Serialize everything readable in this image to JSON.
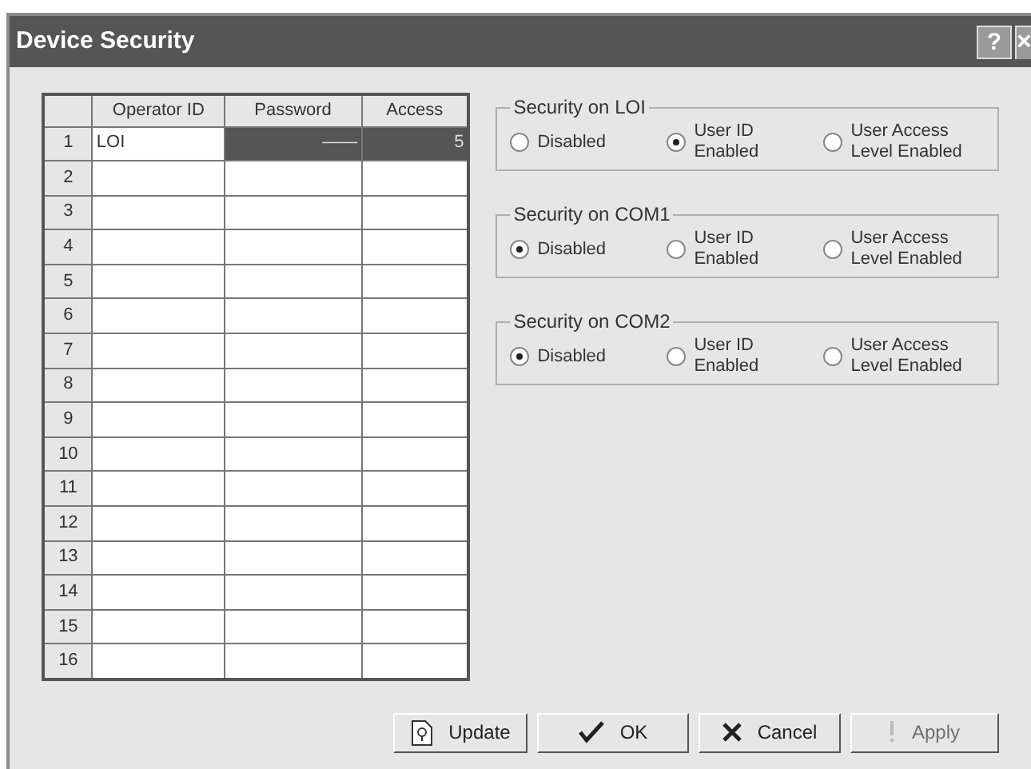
{
  "window": {
    "title": "Device Security",
    "help_button": "?",
    "close_button": "×"
  },
  "table": {
    "columns": [
      "Operator ID",
      "Password",
      "Access"
    ],
    "rows": [
      {
        "number": "1",
        "operator_id": "LOI",
        "password": "——",
        "access": "5",
        "selected": true
      },
      {
        "number": "2",
        "selected": false
      },
      {
        "number": "3",
        "selected": false
      },
      {
        "number": "4",
        "selected": false
      },
      {
        "number": "5",
        "selected": false
      },
      {
        "number": "6",
        "selected": false
      },
      {
        "number": "7",
        "selected": false
      },
      {
        "number": "8",
        "selected": false
      },
      {
        "number": "9",
        "selected": false
      },
      {
        "number": "10",
        "selected": false
      },
      {
        "number": "11",
        "selected": false
      },
      {
        "number": "12",
        "selected": false
      },
      {
        "number": "13",
        "selected": false
      },
      {
        "number": "14",
        "selected": false
      },
      {
        "number": "15",
        "selected": false
      },
      {
        "number": "16",
        "selected": false
      }
    ]
  },
  "groups": [
    {
      "title": "Security on LOI",
      "options": [
        {
          "label": "Disabled",
          "selected": false
        },
        {
          "label": "User ID\nEnabled",
          "selected": true
        },
        {
          "label": "User Access\nLevel Enabled",
          "selected": false
        }
      ]
    },
    {
      "title": "Security on COM1",
      "options": [
        {
          "label": "Disabled",
          "selected": true
        },
        {
          "label": "User ID\nEnabled",
          "selected": false
        },
        {
          "label": "User Access\nLevel Enabled",
          "selected": false
        }
      ]
    },
    {
      "title": "Security on COM2",
      "options": [
        {
          "label": "Disabled",
          "selected": true
        },
        {
          "label": "User ID\nEnabled",
          "selected": false
        },
        {
          "label": "User Access\nLevel Enabled",
          "selected": false
        }
      ]
    }
  ],
  "buttons": [
    {
      "kind": "update",
      "label": "Update",
      "disabled": false
    },
    {
      "kind": "ok",
      "label": "OK",
      "disabled": false
    },
    {
      "kind": "cancel",
      "label": "Cancel",
      "disabled": false
    },
    {
      "kind": "apply",
      "label": "Apply",
      "disabled": true
    }
  ]
}
